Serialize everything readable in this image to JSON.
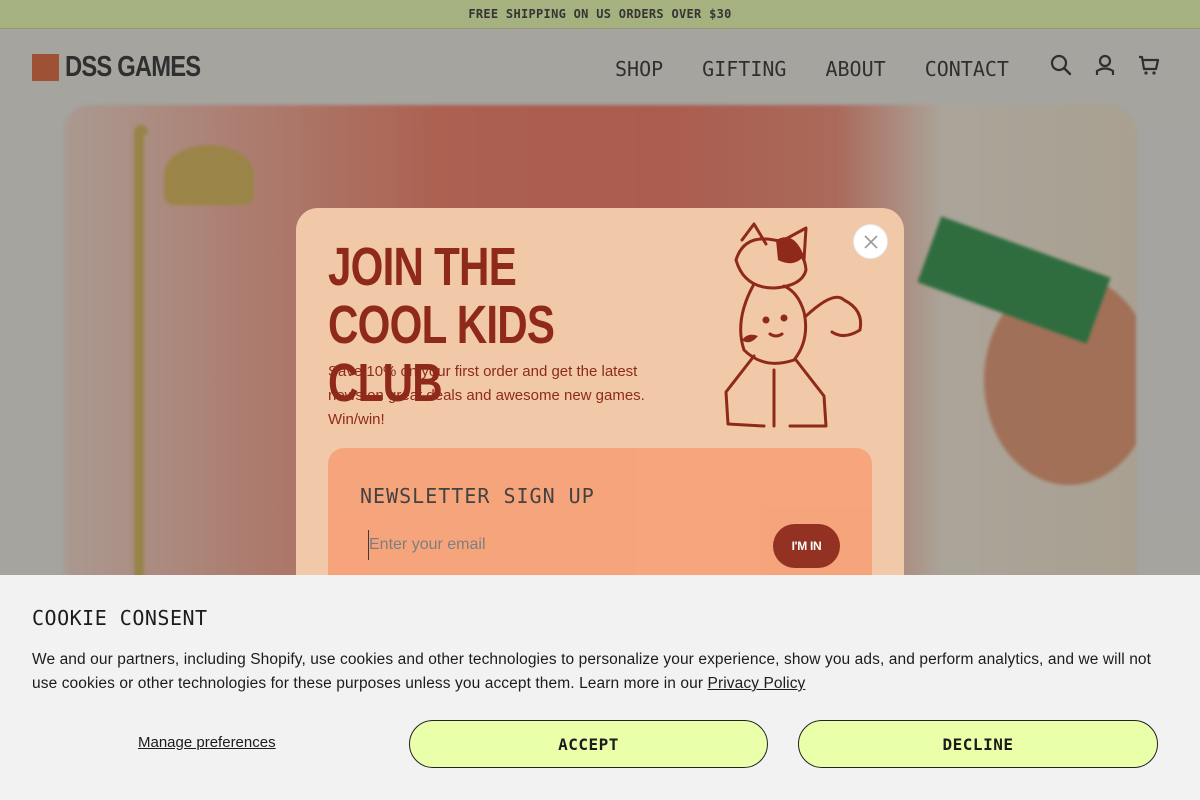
{
  "announcement": {
    "text": "FREE SHIPPING ON US ORDERS OVER $30"
  },
  "header": {
    "logo_text": "DSS GAMES",
    "nav": [
      "SHOP",
      "GIFTING",
      "ABOUT",
      "CONTACT"
    ],
    "icons": [
      "search-icon",
      "account-icon",
      "cart-icon"
    ]
  },
  "modal": {
    "title": "JOIN THE COOL KIDS CLUB",
    "description": "Save 10% on your first order and get the latest news on great deals and awesome new games. Win/win!",
    "signup_label": "NEWSLETTER SIGN UP",
    "email_placeholder": "Enter your email",
    "submit_label": "I'M IN",
    "close_icon": "close-icon"
  },
  "cookie": {
    "title": "COOKIE CONSENT",
    "body": "We and our partners, including Shopify, use cookies and other technologies to personalize your experience, show you ads, and perform analytics, and we will not use cookies or other technologies for these purposes unless you accept them. Learn more in our",
    "privacy_link": "Privacy Policy",
    "manage_label": "Manage preferences",
    "accept_label": "ACCEPT",
    "decline_label": "DECLINE"
  },
  "colors": {
    "accent_lime": "#eaffa9",
    "brand_orange": "#e05a2b",
    "modal_bg": "#f1c9a9",
    "modal_text": "#8f2a1b"
  }
}
